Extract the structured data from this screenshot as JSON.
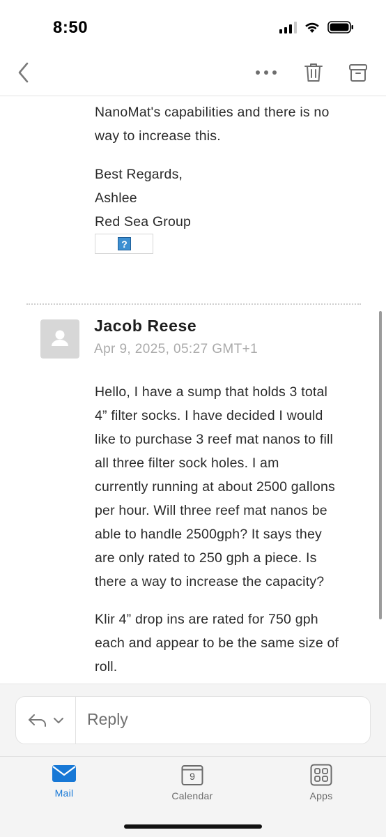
{
  "status_bar": {
    "time": "8:50"
  },
  "toolbar": {
    "back_icon": "chevron-left-icon",
    "more_icon": "more-horizontal-icon",
    "delete_icon": "trash-icon",
    "archive_icon": "archive-icon"
  },
  "previous_message": {
    "lines": [
      "NanoMat's capabilities and there is no",
      "way to increase this."
    ],
    "signoff": [
      "Best Regards,",
      "Ashlee",
      "Red Sea Group"
    ],
    "broken_image_glyph": "?"
  },
  "message": {
    "sender": "Jacob Reese",
    "date": "Apr 9, 2025, 05:27 GMT+1",
    "paragraph1": [
      "Hello, I have a sump that holds 3 total",
      "4” filter socks. I have decided I would",
      "like to purchase 3 reef mat nanos to fill",
      "all three filter sock holes. I am",
      "currently running at about 2500 gallons",
      "per hour. Will three reef mat nanos be",
      "able to handle 2500gph? It says they",
      "are only rated to 250 gph a piece. Is",
      "there a way to increase the capacity?"
    ],
    "paragraph2": [
      "Klir 4” drop ins are rated for 750 gph",
      "each and appear to be the same size of",
      "roll."
    ]
  },
  "reply": {
    "placeholder": "Reply"
  },
  "tab_bar": {
    "mail": "Mail",
    "calendar": "Calendar",
    "calendar_day": "9",
    "apps": "Apps",
    "accent_color": "#1778d6"
  }
}
